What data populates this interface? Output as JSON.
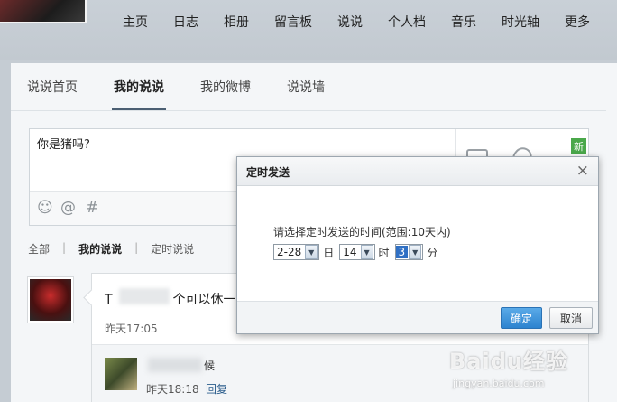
{
  "nav": {
    "items": [
      "主页",
      "日志",
      "相册",
      "留言板",
      "说说",
      "个人档",
      "音乐",
      "时光轴",
      "更多"
    ]
  },
  "tabs": [
    {
      "label": "说说首页",
      "active": false
    },
    {
      "label": "我的说说",
      "active": true
    },
    {
      "label": "我的微博",
      "active": false
    },
    {
      "label": "说说墙",
      "active": false
    }
  ],
  "composer": {
    "text": "你是猪吗?",
    "icons": [
      "smiley-icon",
      "at-icon",
      "hashtag-icon",
      "camera-icon",
      "paperclip-icon",
      "template-icon"
    ],
    "badge": "新"
  },
  "filter": {
    "items": [
      {
        "label": "全部",
        "active": false
      },
      {
        "label": "我的说说",
        "active": true
      },
      {
        "label": "定时说说",
        "active": false
      }
    ],
    "separator": "|"
  },
  "feed": {
    "text_prefix": "T",
    "text_visible": "个可以休一个",
    "time": "昨天17:05",
    "reply": {
      "text_suffix": "候",
      "time": "昨天18:18",
      "action": "回复"
    }
  },
  "dialog": {
    "title": "定时发送",
    "close": "×",
    "tip": "请选择定时发送的时间(范围:10天内)",
    "date_value": "2-28",
    "date_unit": "日",
    "hour_value": "14",
    "hour_unit": "时",
    "minute_value": "3",
    "minute_unit": "分",
    "ok_label": "确定",
    "cancel_label": "取消",
    "accent": "#2d83cf"
  },
  "watermark": {
    "logo": "Baidu经验",
    "url": "jingyan.baidu.com"
  }
}
